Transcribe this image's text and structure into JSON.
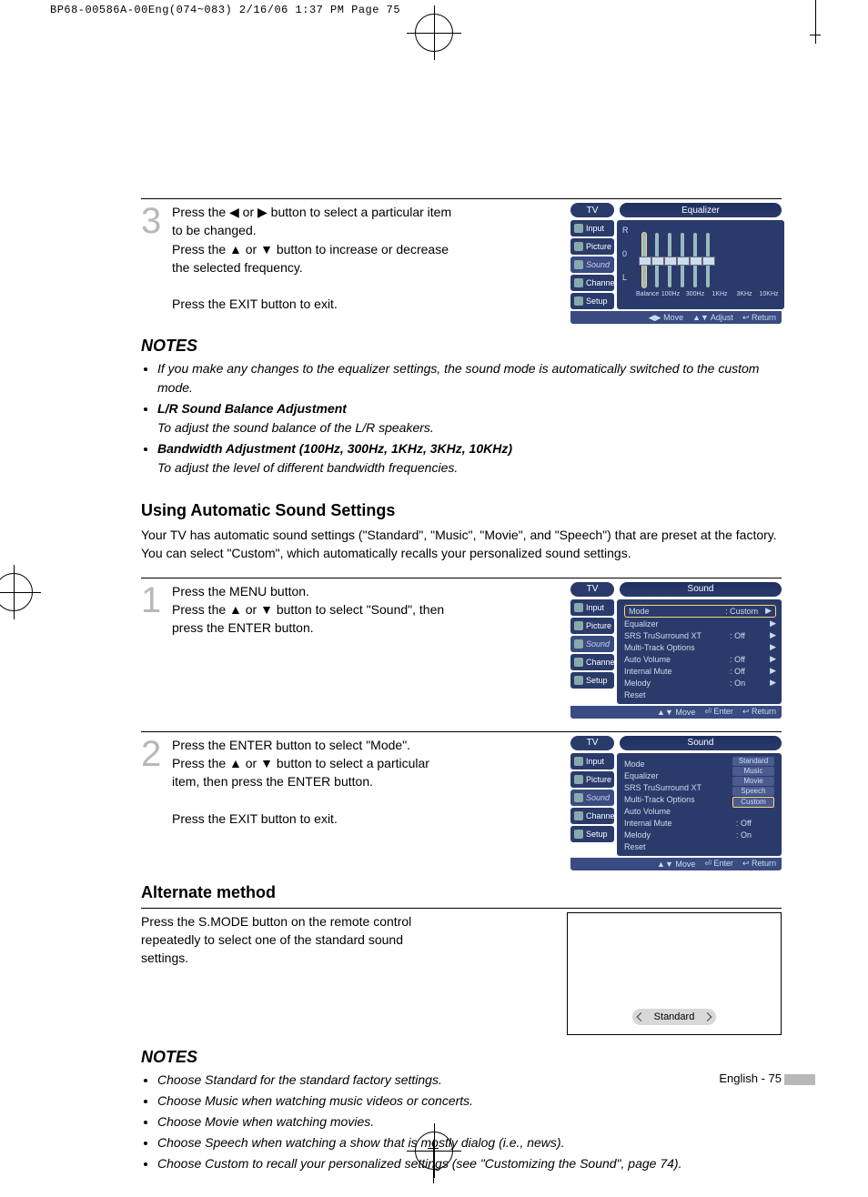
{
  "header_line": "BP68-00586A-00Eng(074~083)  2/16/06  1:37 PM  Page 75",
  "step3": {
    "num": "3",
    "p1": "Press the ◀ or ▶ button to select a particular item to be changed.",
    "p2": "Press the ▲ or ▼ button to increase or decrease the selected frequency.",
    "p3": "Press the EXIT button to exit."
  },
  "osd_eq": {
    "tv": "TV",
    "title": "Equalizer",
    "side": [
      "Input",
      "Picture",
      "Sound",
      "Channel",
      "Setup"
    ],
    "ylabels": [
      "R",
      "0",
      "L"
    ],
    "xlabels": [
      "Balance",
      "100Hz",
      "300Hz",
      "1KHz",
      "3KHz",
      "10KHz"
    ],
    "foot": [
      "◀▶ Move",
      "▲▼ Adjust",
      "↩ Return"
    ]
  },
  "notes1": {
    "title": "NOTES",
    "items": [
      "If you make any changes to the equalizer settings, the sound mode is automatically switched to the custom mode.",
      "L/R Sound Balance Adjustment",
      "To adjust the sound balance of the L/R speakers.",
      "Bandwidth Adjustment (100Hz, 300Hz, 1KHz, 3KHz, 10KHz)",
      "To adjust the level of different bandwidth frequencies."
    ]
  },
  "section2": {
    "title": "Using Automatic Sound Settings",
    "intro": "Your TV has automatic sound settings (\"Standard\", \"Music\", \"Movie\", and \"Speech\") that are preset at the factory. You can select \"Custom\", which automatically recalls your personalized sound settings."
  },
  "step1": {
    "num": "1",
    "p1": "Press the MENU button.",
    "p2": "Press the ▲ or ▼ button to select \"Sound\", then press the ENTER button."
  },
  "osd_sound1": {
    "tv": "TV",
    "title": "Sound",
    "side": [
      "Input",
      "Picture",
      "Sound",
      "Channel",
      "Setup"
    ],
    "rows": [
      {
        "lbl": "Mode",
        "val": ": Custom",
        "arr": "▶",
        "boxed": true
      },
      {
        "lbl": "Equalizer",
        "val": "",
        "arr": "▶"
      },
      {
        "lbl": "SRS TruSurround XT",
        "val": ": Off",
        "arr": "▶"
      },
      {
        "lbl": "Multi-Track Options",
        "val": "",
        "arr": "▶"
      },
      {
        "lbl": "Auto Volume",
        "val": ": Off",
        "arr": "▶"
      },
      {
        "lbl": "Internal Mute",
        "val": ": Off",
        "arr": "▶"
      },
      {
        "lbl": "Melody",
        "val": ": On",
        "arr": "▶"
      },
      {
        "lbl": "Reset",
        "val": "",
        "arr": ""
      }
    ],
    "foot": [
      "▲▼ Move",
      "⏎ Enter",
      "↩ Return"
    ]
  },
  "step2": {
    "num": "2",
    "p1": "Press the ENTER button to select \"Mode\".",
    "p2": "Press the ▲ or ▼ button to select a particular item, then press the ENTER button.",
    "p3": "Press the EXIT button to exit."
  },
  "osd_sound2": {
    "tv": "TV",
    "title": "Sound",
    "side": [
      "Input",
      "Picture",
      "Sound",
      "Channel",
      "Setup"
    ],
    "left_rows": [
      "Mode",
      "Equalizer",
      "SRS TruSurround XT",
      "Multi-Track Options",
      "Auto Volume",
      "Internal Mute",
      "Melody",
      "Reset"
    ],
    "left_vals": [
      "",
      "",
      "",
      "",
      "",
      ": Off",
      ": On",
      ""
    ],
    "opts": [
      "Standard",
      "Music",
      "Movie",
      "Speech",
      "Custom"
    ],
    "foot": [
      "▲▼ Move",
      "⏎ Enter",
      "↩ Return"
    ]
  },
  "alt": {
    "title": "Alternate method",
    "text": "Press the S.MODE button on the remote control repeatedly to select one of the standard sound settings.",
    "pill": "Standard"
  },
  "notes2": {
    "title": "NOTES",
    "items": [
      "Choose Standard for the standard factory settings.",
      "Choose Music when watching music videos or concerts.",
      "Choose Movie when watching movies.",
      "Choose Speech when watching a show that is mostly dialog (i.e., news).",
      "Choose Custom to recall your personalized settings (see \"Customizing the Sound\", page 74)."
    ]
  },
  "page_footer": "English - 75"
}
